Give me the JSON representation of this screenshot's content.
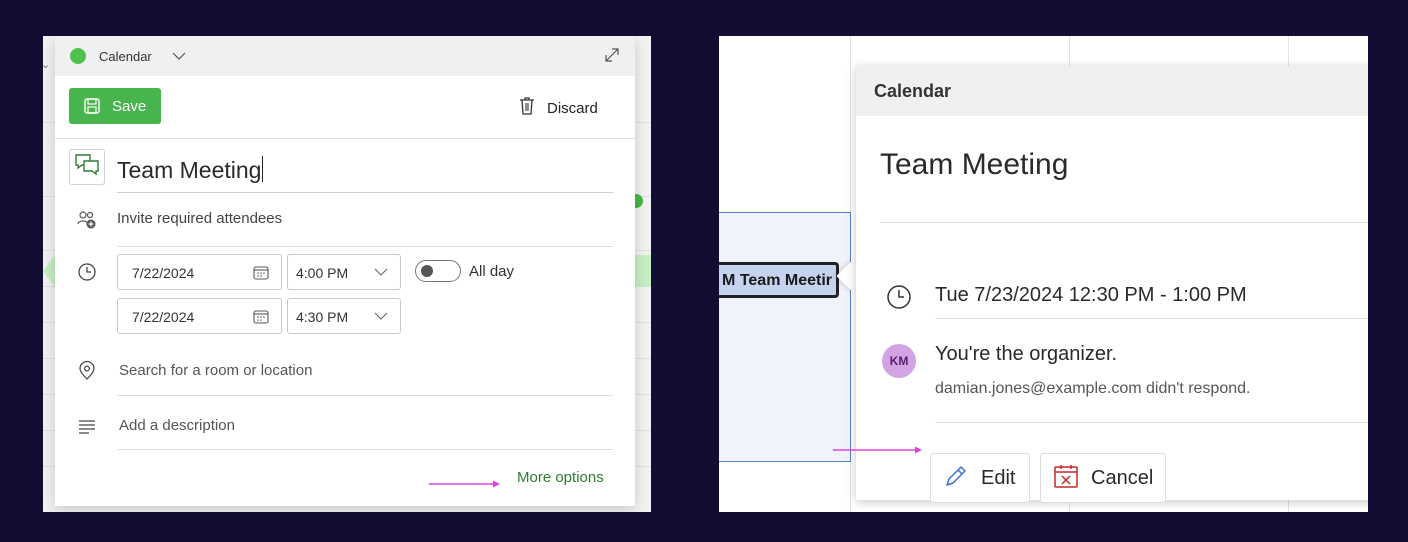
{
  "colors": {
    "background": "#120e33",
    "save_green": "#48b44e",
    "calendar_dot": "#4ec24e",
    "more_options_green": "#2e7d32",
    "annotation_arrow": "#e040e0",
    "event_border": "#5b7fcf",
    "avatar_bg": "#d3a3e3"
  },
  "compose": {
    "calendar_name": "Calendar",
    "save_label": "Save",
    "discard_label": "Discard",
    "title": "Team Meeting",
    "attendees_placeholder": "Invite required attendees",
    "start_date": "7/22/2024",
    "start_time": "4:00 PM",
    "end_date": "7/22/2024",
    "end_time": "4:30 PM",
    "all_day_label": "All day",
    "all_day_on": false,
    "location_placeholder": "Search for a room or location",
    "description_placeholder": "Add a description",
    "more_options_label": "More options",
    "icons": [
      "chevron-down-icon",
      "expand-icon",
      "save-icon",
      "trash-icon",
      "chat-icon",
      "people-add-icon",
      "clock-icon",
      "calendar-grid-icon",
      "location-icon",
      "text-lines-icon"
    ]
  },
  "event_preview": {
    "chip_label": "M Team Meetir",
    "calendar_name": "Calendar",
    "title": "Team Meeting",
    "time": "Tue 7/23/2024 12:30 PM - 1:00 PM",
    "avatar_initials": "KM",
    "organizer_text": "You're the organizer.",
    "response_text": "damian.jones@example.com didn't respond.",
    "edit_label": "Edit",
    "cancel_label": "Cancel",
    "icons": [
      "clock-icon",
      "pencil-icon",
      "calendar-cancel-icon"
    ]
  }
}
